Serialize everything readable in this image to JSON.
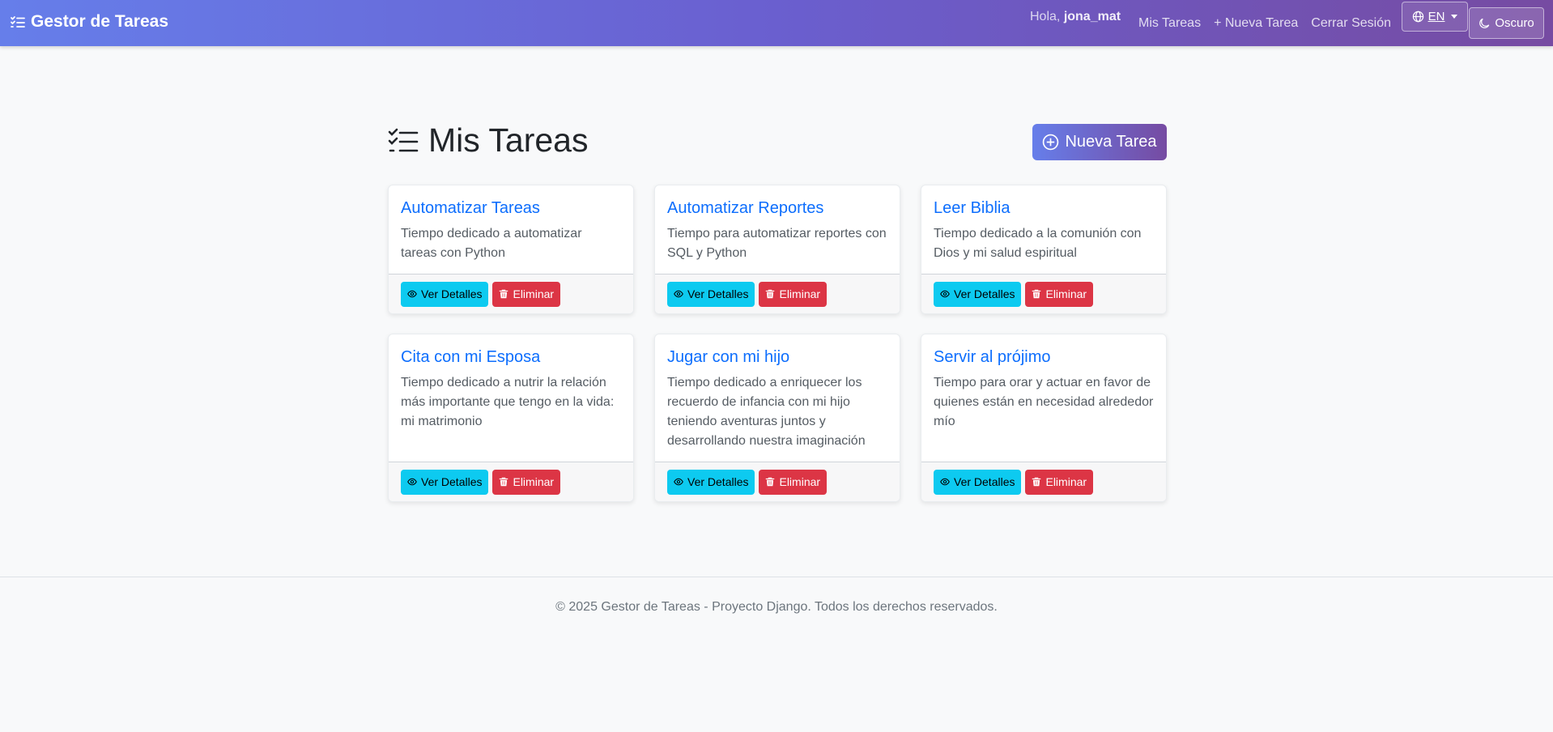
{
  "nav": {
    "brand": "Gestor de Tareas",
    "greeting_prefix": "Hola,",
    "username": "jona_mat",
    "links": [
      "Mis Tareas",
      "+ Nueva Tarea",
      "Cerrar Sesión"
    ],
    "lang": "EN",
    "theme": "Oscuro"
  },
  "main": {
    "title": "Mis Tareas",
    "new_button": "Nueva Tarea",
    "view_label": "Ver Detalles",
    "delete_label": "Eliminar",
    "tasks": [
      {
        "title": "Automatizar Tareas",
        "desc": "Tiempo dedicado a automatizar tareas con Python"
      },
      {
        "title": "Automatizar Reportes",
        "desc": "Tiempo para automatizar reportes con SQL y Python"
      },
      {
        "title": "Leer Biblia",
        "desc": "Tiempo dedicado a la comunión con Dios y mi salud espiritual"
      },
      {
        "title": "Cita con mi Esposa",
        "desc": "Tiempo dedicado a nutrir la relación más importante que tengo en la vida: mi matrimonio"
      },
      {
        "title": "Jugar con mi hijo",
        "desc": "Tiempo dedicado a enriquecer los recuerdo de infancia con mi hijo teniendo aventuras juntos y desarrollando nuestra imaginación"
      },
      {
        "title": "Servir al prójimo",
        "desc": "Tiempo para orar y actuar en favor de quienes están en necesidad alrededor mío"
      }
    ]
  },
  "footer": {
    "text": "© 2025 Gestor de Tareas - Proyecto Django. Todos los derechos reservados."
  }
}
